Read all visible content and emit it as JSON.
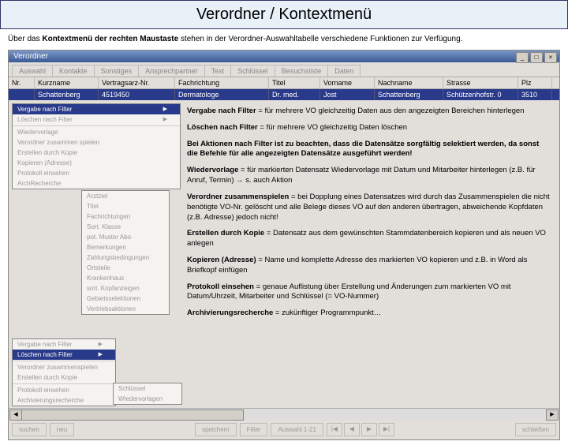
{
  "title": "Verordner / Kontextmenü",
  "intro_pre": "Über das ",
  "intro_bold": "Kontextmenü der rechten Maustaste",
  "intro_post": " stehen in der Verordner-Auswahltabelle verschiedene Funktionen zur Verfügung.",
  "window_title": "Verordner",
  "tabs": [
    "Auswahl",
    "Kontakte",
    "Sonstiges",
    "Ansprechpartner",
    "Text",
    "Schlüssel",
    "Besuchsliste",
    "Daten"
  ],
  "cols": {
    "nr": "Nr.",
    "kurz": "Kurzname",
    "vert": "Vertragsarz-Nr.",
    "fach": "Fachrichtung",
    "titel": "Titel",
    "vor": "Vorname",
    "nach": "Nachname",
    "str": "Strasse",
    "plz": "Plz"
  },
  "row": {
    "nr": "",
    "kurz": "Schattenberg",
    "vert": "4519450",
    "fach": "Dermatologe",
    "titel": "Dr. med.",
    "vor": "Jost",
    "nach": "Schattenberg",
    "str": "Schützenhofstr. 0",
    "plz": "3510"
  },
  "menu1": [
    {
      "l": "Vergabe nach Filter",
      "a": true,
      "sel": true
    },
    {
      "l": "Löschen nach Filter",
      "a": true
    },
    {
      "sep": true
    },
    {
      "l": "Wiedervorlage"
    },
    {
      "l": "Verordner zusammen spielen"
    },
    {
      "l": "Erstellen durch Kopie"
    },
    {
      "l": "Kopieren (Adresse)"
    },
    {
      "l": "Protokoll einsehen"
    },
    {
      "l": "ArchRecherche"
    }
  ],
  "menu2": [
    {
      "l": "Arztziel"
    },
    {
      "l": "Titel"
    },
    {
      "l": "Fachrichtungen"
    },
    {
      "l": "Sort. Klasse"
    },
    {
      "l": "pot. Muster Abo"
    },
    {
      "l": "Bemerkungen"
    },
    {
      "l": "Zahlungsbedingungen"
    },
    {
      "l": "Ortsteile"
    },
    {
      "l": "Krankenhaus"
    },
    {
      "l": "sort. Kopfanzeigen"
    },
    {
      "l": "Gebietsselektionen"
    },
    {
      "l": "Vertriebsaktionen"
    }
  ],
  "menu3": [
    {
      "l": "Vergabe nach Filter",
      "a": true
    },
    {
      "l": "Löschen nach Filter",
      "a": true,
      "sel": true
    },
    {
      "sep": true
    },
    {
      "l": "Verordner zusammenspielen"
    },
    {
      "l": "Erstellen durch Kopie"
    },
    {
      "sep": true
    },
    {
      "l": "Protokoll einsehen"
    },
    {
      "l": "Archivierungsrecherche"
    }
  ],
  "menu3b": [
    {
      "l": "Schlüssel"
    },
    {
      "l": "Wiedervorlagen"
    }
  ],
  "descs": [
    {
      "b": "Vergabe nach Filter",
      "t": " = für mehrere VO gleichzeitig Daten aus den angezeigten Bereichen hinterlegen"
    },
    {
      "b": "Löschen nach Filter",
      "t": " = für mehrere VO gleichzeitig Daten löschen"
    },
    {
      "b": "Bei Aktionen nach Filter ist zu beachten, dass die Datensätze sorgfältig selektiert werden, da sonst die Befehle für alle angezeigten Datensätze ausgeführt werden!",
      "t": ""
    },
    {
      "b": "Wiedervorlage",
      "t": " = für markierten Datensatz Wiedervorlage mit Datum und Mitarbeiter hinterlegen (z.B. für Anruf, Termin) → s. auch Aktion"
    },
    {
      "b": "Verordner zusammenspielen",
      "t": " = bei Dopplung eines Datensatzes wird durch das Zusammenspielen die nicht benötigte VO-Nr. gelöscht und alle Belege dieses VO auf den anderen übertragen, abweichende Kopfdaten (z.B. Adresse) jedoch nicht!"
    },
    {
      "b": "Erstellen durch Kopie",
      "t": " = Datensatz aus dem gewünschten Stammdatenbereich kopieren und als neuen VO anlegen"
    },
    {
      "b": "Kopieren (Adresse)",
      "t": " = Name und komplette Adresse des markierten VO kopieren und z.B. in Word als Briefkopf einfügen"
    },
    {
      "b": "Protokoll einsehen",
      "t": " = genaue Auflistung über Erstellung und Änderungen zum markierten VO mit Datum/Uhrzeit, Mitarbeiter und Schlüssel (= VO-Nummer)"
    },
    {
      "b": "Archivierungsrecherche",
      "t": " = zukünftiger Programmpunkt…"
    }
  ],
  "buttons": {
    "suchen": "suchen",
    "neu": "neu",
    "speichern": "speichern",
    "filter": "Filter",
    "auswahl": "Auswahl 1-21",
    "schliessen": "schließen"
  },
  "nav": {
    "first": "|◀",
    "prev": "◀",
    "next": "▶",
    "last": "▶|"
  }
}
